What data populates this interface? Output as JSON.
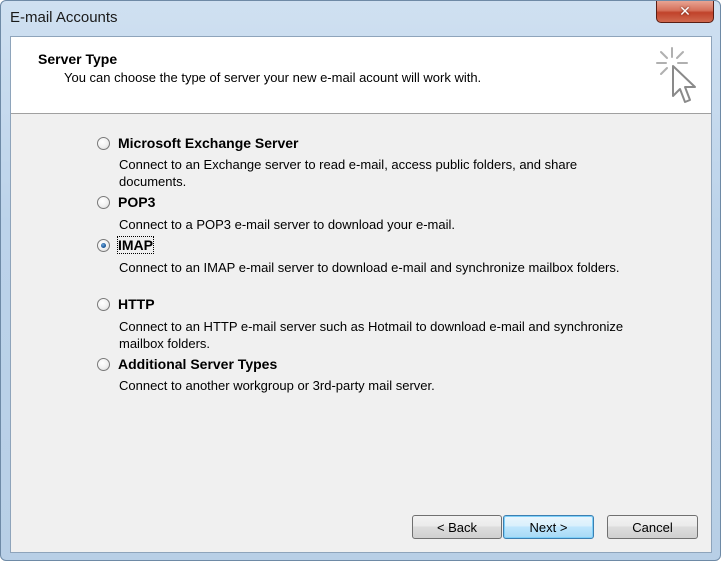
{
  "window": {
    "title": "E-mail Accounts",
    "close_symbol": "✕"
  },
  "header": {
    "title": "Server Type",
    "description": "You can choose the type of server your new e-mail acount will work with.",
    "icon": "wizard-cursor-sparkle-icon"
  },
  "options": [
    {
      "label": "Microsoft Exchange Server",
      "description": "Connect to an Exchange server to read e-mail, access public folders, and share documents.",
      "checked": false
    },
    {
      "label": "POP3",
      "description": "Connect to a POP3 e-mail server to download your e-mail.",
      "checked": false
    },
    {
      "label": "IMAP",
      "description": "Connect to an IMAP e-mail server to download e-mail and synchronize mailbox folders.",
      "checked": true
    },
    {
      "label": "HTTP",
      "description": "Connect to an HTTP e-mail server such as Hotmail to download e-mail and synchronize mailbox folders.",
      "checked": false
    },
    {
      "label": "Additional Server Types",
      "description": "Connect to another workgroup or 3rd-party mail server.",
      "checked": false
    }
  ],
  "buttons": {
    "back": "< Back",
    "next": "Next >",
    "cancel": "Cancel"
  }
}
